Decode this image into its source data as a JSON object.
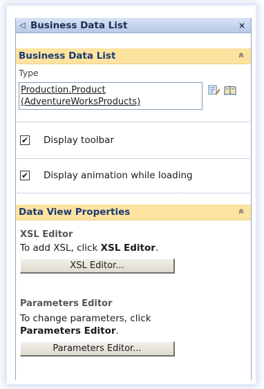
{
  "panel": {
    "title": "Business Data List",
    "close_glyph": "×",
    "arrow_glyph": "◁"
  },
  "section1": {
    "title": "Business Data List",
    "collapse_glyph": "⌃",
    "type_label": "Type",
    "type_line1": "Production.Product",
    "type_line2": "(AdventureWorksProducts)",
    "icons": [
      "edit-list-icon",
      "book-icon"
    ],
    "checkbox_display_toolbar": {
      "label": "Display toolbar",
      "checked": true,
      "mark": "✔"
    },
    "checkbox_display_animation": {
      "label": "Display animation while loading",
      "checked": true,
      "mark": "✔"
    }
  },
  "section2": {
    "title": "Data View Properties",
    "collapse_glyph": "⌃",
    "xsl_title": "XSL Editor",
    "xsl_text_prefix": "To add XSL, click ",
    "xsl_text_bold": "XSL Editor",
    "xsl_text_suffix": ".",
    "xsl_button": "XSL Editor...",
    "params_title": "Parameters Editor",
    "params_text": "To change parameters, click",
    "params_text_bold": "Parameters Editor",
    "params_text_suffix": ".",
    "params_button": "Parameters Editor..."
  },
  "colors": {
    "header_bg": "#fde3a0",
    "header_text": "#1b3a72",
    "title_bar": "#c6d6ee"
  }
}
